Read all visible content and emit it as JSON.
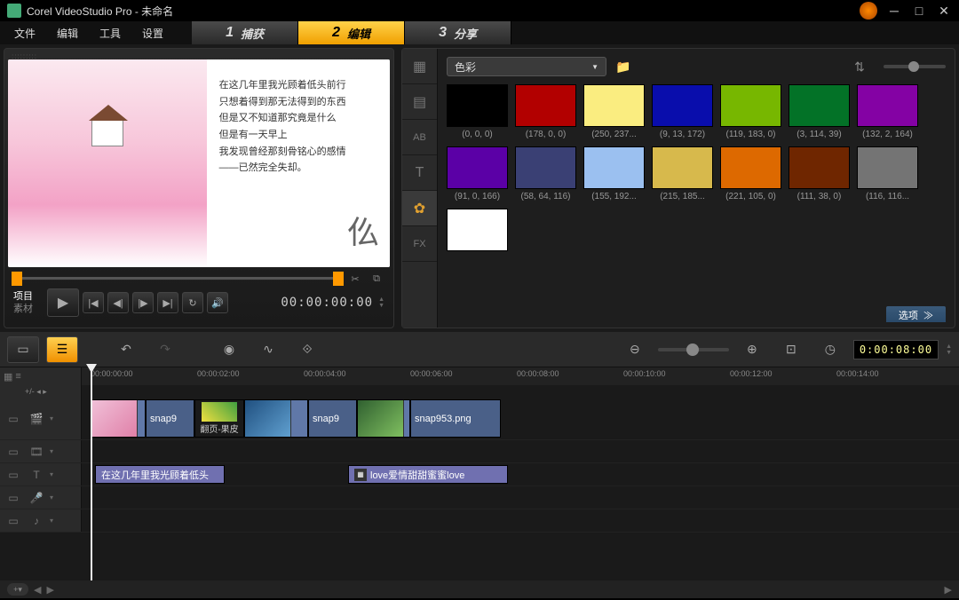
{
  "titlebar": {
    "app_title": "Corel VideoStudio Pro - 未命名"
  },
  "menu": {
    "file": "文件",
    "edit": "编辑",
    "tools": "工具",
    "settings": "设置"
  },
  "steps": [
    {
      "num": "1",
      "label": "捕获"
    },
    {
      "num": "2",
      "label": "编辑"
    },
    {
      "num": "3",
      "label": "分享"
    }
  ],
  "preview": {
    "poem_lines": [
      "在这几年里我光顾着低头前行",
      "只想着得到那无法得到的东西",
      "但是又不知道那究竟是什么",
      "但是有一天早上",
      "我发现曾经那刻骨铭心的感情",
      "——已然完全失却。"
    ],
    "mode_project": "项目",
    "mode_clip": "素材",
    "timecode": "00:00:00:00"
  },
  "library": {
    "dropdown": "色彩",
    "options_label": "选项",
    "swatches": [
      {
        "rgb": "(0, 0, 0)",
        "hex": "#000000"
      },
      {
        "rgb": "(178, 0, 0)",
        "hex": "#b20000"
      },
      {
        "rgb": "(250, 237...",
        "hex": "#faed80"
      },
      {
        "rgb": "(9, 13, 172)",
        "hex": "#090dac"
      },
      {
        "rgb": "(119, 183, 0)",
        "hex": "#77b700"
      },
      {
        "rgb": "(3, 114, 39)",
        "hex": "#037227"
      },
      {
        "rgb": "(132, 2, 164)",
        "hex": "#8402a4"
      },
      {
        "rgb": "(91, 0, 166)",
        "hex": "#5b00a6"
      },
      {
        "rgb": "(58, 64, 116)",
        "hex": "#3a4074"
      },
      {
        "rgb": "(155, 192...",
        "hex": "#9bc0f0"
      },
      {
        "rgb": "(215, 185...",
        "hex": "#d7b94c"
      },
      {
        "rgb": "(221, 105, 0)",
        "hex": "#dd6900"
      },
      {
        "rgb": "(111, 38, 0)",
        "hex": "#6f2600"
      },
      {
        "rgb": "(116, 116...",
        "hex": "#747474"
      },
      {
        "rgb": "",
        "hex": "#ffffff"
      }
    ]
  },
  "timeline": {
    "ruler": [
      "00:00:00:00",
      "00:00:02:00",
      "00:00:04:00",
      "00:00:06:00",
      "00:00:08:00",
      "00:00:10:00",
      "00:00:12:00",
      "00:00:14:00"
    ],
    "current_tc": "0:00:08:00",
    "clip1_label": "snap9",
    "trans_label": "翻页-果皮",
    "clip2_label": "snap9",
    "clip3_label": "snap953.png",
    "title1": "在这几年里我光顾着低头",
    "title2": "love爱情甜甜蜜蜜love"
  }
}
